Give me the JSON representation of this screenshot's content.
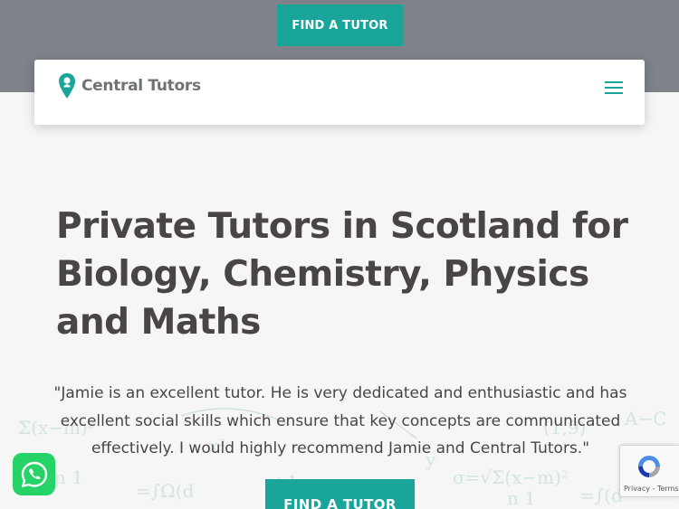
{
  "top_band": {
    "cta_label": "FIND A TUTOR"
  },
  "header": {
    "logo_text": "Central Tutors",
    "menu_icon": "hamburger-menu-icon"
  },
  "hero": {
    "title": "Private Tutors in Scotland for Biology, Chemistry, Physics and Maths",
    "quote": "\"Jamie is an excellent tutor. He is very dedicated and enthusiastic and has excellent social skills which ensure that key concepts are communicated effectively. I would highly recommend Jamie and Central Tutors.\"",
    "cta_label": "FIND A TUTOR"
  },
  "widgets": {
    "whatsapp_icon": "whatsapp-icon",
    "recaptcha_privacy": "Privacy",
    "recaptcha_sep": "-",
    "recaptcha_terms": "Terms"
  },
  "colors": {
    "accent": "#1aa59a",
    "top_band": "#7d8388",
    "text": "#4a4545",
    "whatsapp": "#25d366"
  }
}
